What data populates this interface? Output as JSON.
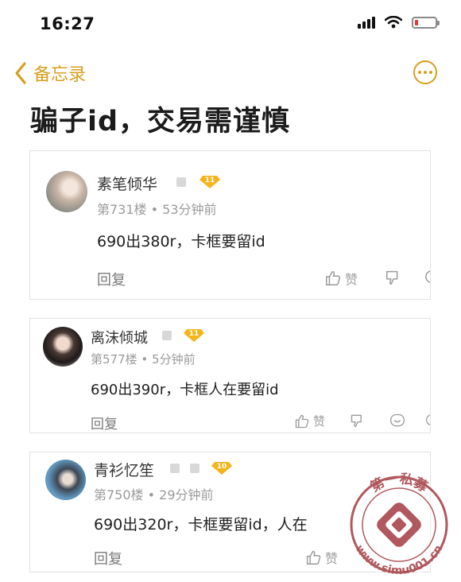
{
  "status_bar": {
    "time": "16:27",
    "battery_level": 0.1
  },
  "nav": {
    "back_label": "备忘录"
  },
  "title": "骗子id，交易需谨慎",
  "comments": [
    {
      "username": "素笔倾华",
      "level": "11",
      "floor": "第731楼",
      "time_ago": "53分钟前",
      "content": "690出380r，卡框要留id",
      "reply_label": "回复",
      "like_label": "赞"
    },
    {
      "username": "离沫倾城",
      "level": "11",
      "floor": "第577楼",
      "time_ago": "5分钟前",
      "content": "690出390r，卡框人在要留id",
      "reply_label": "回复",
      "like_label": "赞"
    },
    {
      "username": "青衫忆笙",
      "level": "10",
      "floor": "第750楼",
      "time_ago": "29分钟前",
      "content": "690出320r，卡框要留id，人在",
      "reply_label": "回复",
      "like_label": "赞"
    }
  ],
  "watermark": {
    "top_text": "第一私募",
    "url": "www.simu001.cn"
  },
  "colors": {
    "accent": "#d79f1d",
    "badge": "#f5b41c",
    "meta": "#9b9b9b"
  }
}
